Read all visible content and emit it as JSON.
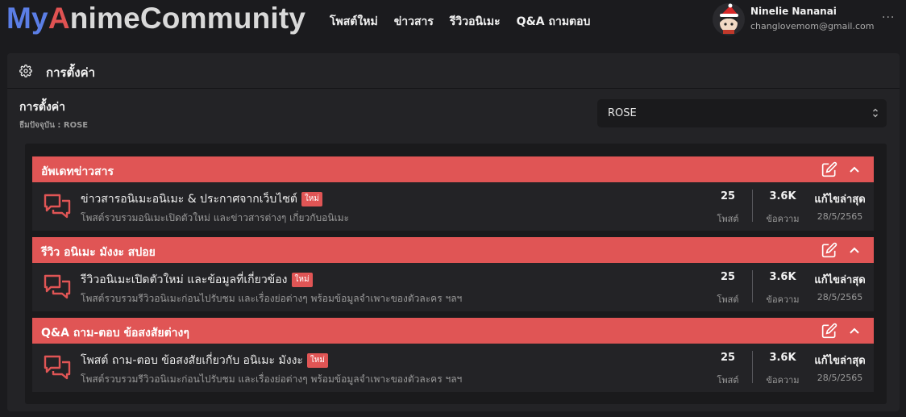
{
  "brand": {
    "part1": "My",
    "part2": "A",
    "part3": "nimeCommunity"
  },
  "nav": [
    "โพสต์ใหม่",
    "ข่าวสาร",
    "รีวิวอนิเมะ",
    "Q&A ถามตอบ"
  ],
  "user": {
    "name": "Ninelie Nananai",
    "email": "changlovemom@gmail.com",
    "more": "···"
  },
  "settings": {
    "title": "การตั้งค่า",
    "label": "การตั้งค่า",
    "current": "ธีมปัจจุบัน : ROSE",
    "select_value": "ROSE"
  },
  "categories": [
    {
      "title": "อัพเดทข่าวสาร",
      "forum": {
        "title": "ข่าวสารอนิเมะอนิเมะ & ประกาศจากเว็บไซต์",
        "badge": "ใหม่",
        "desc": "โพสต์รวบรวมอนิเมะเปิดตัวใหม่ และข่าวสารต่างๆ เกี่ยวกับอนิเมะ",
        "posts": "25",
        "posts_label": "โพสต์",
        "messages": "3.6K",
        "messages_label": "ข้อความ",
        "last_label": "แก้ไขล่าสุด",
        "last_date": "28/5/2565"
      }
    },
    {
      "title": "รีวิว อนิเมะ มังงะ สปอย",
      "forum": {
        "title": "รีวิวอนิเมะเปิดตัวใหม่ และข้อมูลที่เกี่ยวข้อง",
        "badge": "ใหม่",
        "desc": "โพสต์รวบรวมรีวิวอนิเมะก่อนไปรับชม และเรื่องย่อต่างๆ พร้อมข้อมูลจำเพาะของตัวละคร ฯลฯ",
        "posts": "25",
        "posts_label": "โพสต์",
        "messages": "3.6K",
        "messages_label": "ข้อความ",
        "last_label": "แก้ไขล่าสุด",
        "last_date": "28/5/2565"
      }
    },
    {
      "title": "Q&A ถาม-ตอบ ข้อสงสัยต่างๆ",
      "forum": {
        "title": "โพสต์ ถาม-ตอบ ข้อสงสัยเกี่ยวกับ อนิเมะ มังงะ",
        "badge": "ใหม่",
        "desc": "โพสต์รวบรวมรีวิวอนิเมะก่อนไปรับชม และเรื่องย่อต่างๆ พร้อมข้อมูลจำเพาะของตัวละคร ฯลฯ",
        "posts": "25",
        "posts_label": "โพสต์",
        "messages": "3.6K",
        "messages_label": "ข้อความ",
        "last_label": "แก้ไขล่าสุด",
        "last_date": "28/5/2565"
      }
    }
  ],
  "colors": {
    "accent": "#e05555",
    "logo_blue": "#5b7ee6",
    "background": "#1b1b1e"
  },
  "icons": [
    "gear-icon",
    "edit-icon",
    "chevron-up-icon",
    "chat-bubbles-icon",
    "select-arrows-icon"
  ]
}
